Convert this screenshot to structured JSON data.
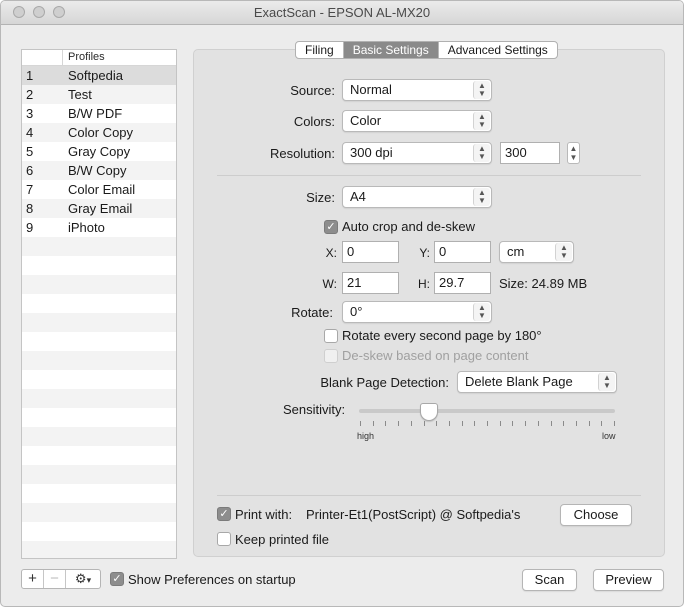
{
  "window": {
    "title": "ExactScan - EPSON AL-MX20"
  },
  "profiles": {
    "header": "Profiles",
    "items": [
      {
        "num": "1",
        "name": "Softpedia"
      },
      {
        "num": "2",
        "name": "Test"
      },
      {
        "num": "3",
        "name": "B/W PDF"
      },
      {
        "num": "4",
        "name": "Color Copy"
      },
      {
        "num": "5",
        "name": "Gray Copy"
      },
      {
        "num": "6",
        "name": "B/W Copy"
      },
      {
        "num": "7",
        "name": "Color Email"
      },
      {
        "num": "8",
        "name": "Gray Email"
      },
      {
        "num": "9",
        "name": "iPhoto"
      }
    ],
    "selected": "Softpedia"
  },
  "list_controls": {
    "add": "+",
    "remove": "−",
    "gear": "⚙",
    "gear_menu": "▾"
  },
  "tabs": [
    "Filing",
    "Basic Settings",
    "Advanced Settings"
  ],
  "active_tab": "Basic Settings",
  "settings": {
    "source_label": "Source:",
    "source_value": "Normal",
    "colors_label": "Colors:",
    "colors_value": "Color",
    "resolution_label": "Resolution:",
    "resolution_value": "300 dpi",
    "resolution_field": "300",
    "size_label": "Size:",
    "size_value": "A4",
    "autocrop_label": "Auto crop and de-skew",
    "x_label": "X:",
    "x_value": "0",
    "y_label": "Y:",
    "y_value": "0",
    "unit_value": "cm",
    "w_label": "W:",
    "w_value": "21",
    "h_label": "H:",
    "h_value": "29.7",
    "size_info": "Size: 24.89 MB",
    "rotate_label": "Rotate:",
    "rotate_value": "0°",
    "rotate_second_label": "Rotate every second page by 180°",
    "deskew_content_label": "De-skew based on page content",
    "blank_label": "Blank Page Detection:",
    "blank_value": "Delete Blank Page",
    "sensitivity_label": "Sensitivity:",
    "sensitivity_level": 0.27,
    "sens_high": "high",
    "sens_low": "low"
  },
  "print": {
    "print_with_label": "Print with:",
    "printer_name": "Printer-Et1(PostScript) @ Softpedia's",
    "choose_label": "Choose",
    "keep_label": "Keep printed file"
  },
  "bottom": {
    "show_prefs_label": "Show Preferences on startup",
    "scan_label": "Scan",
    "preview_label": "Preview"
  },
  "icons": {
    "checkmark": "✓",
    "popup_arrows": "▲▼"
  }
}
